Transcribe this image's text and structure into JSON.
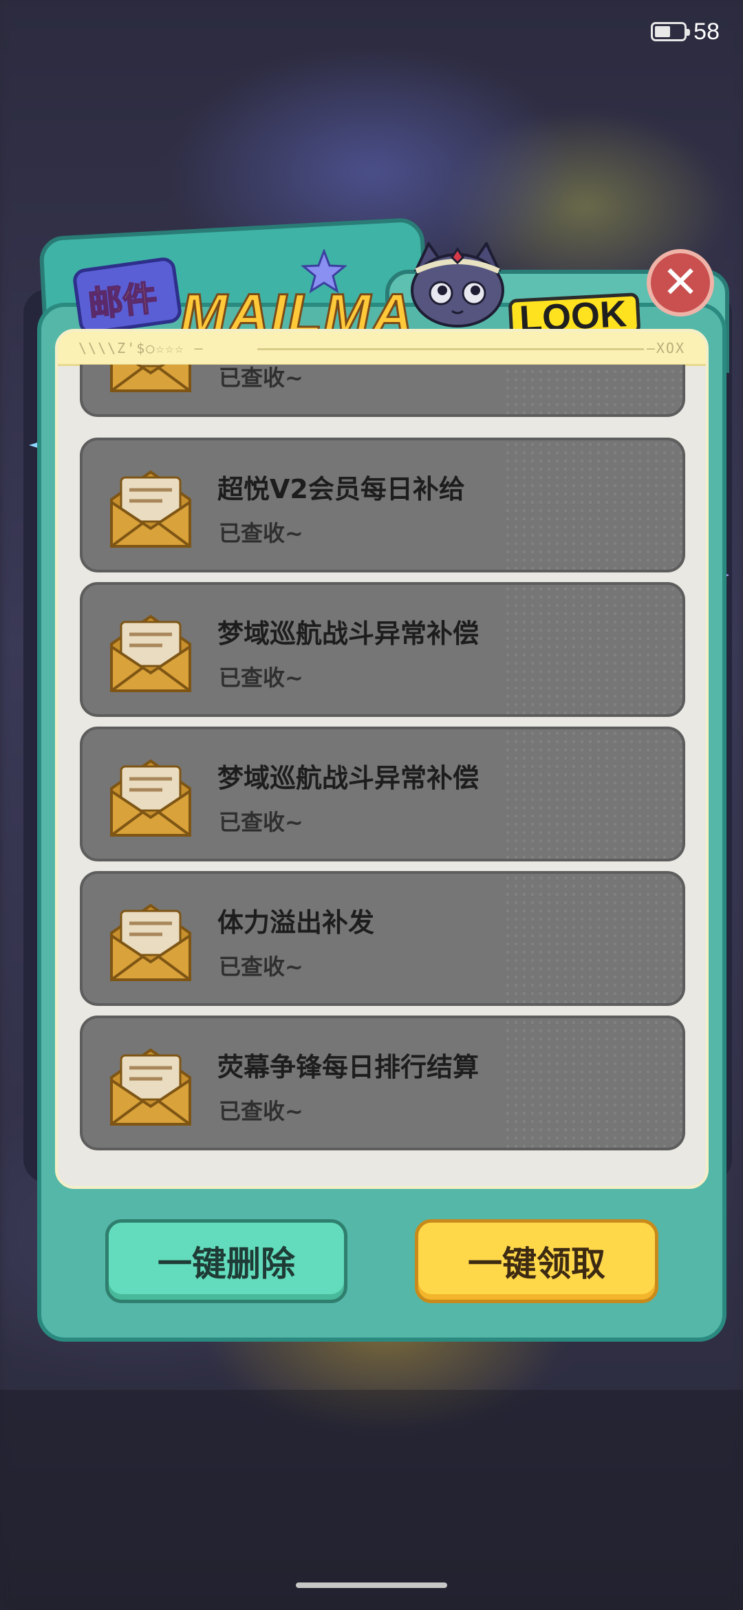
{
  "status_bar": {
    "battery_level": "58"
  },
  "dialog": {
    "badge_label": "邮件",
    "banner_text": "MAILMA",
    "look_text": "LOOK",
    "close_icon": "close-icon",
    "mails": [
      {
        "title": "",
        "status": "已查收~"
      },
      {
        "title": "超悦V2会员每日补给",
        "status": "已查收~"
      },
      {
        "title": "梦域巡航战斗异常补偿",
        "status": "已查收~"
      },
      {
        "title": "梦域巡航战斗异常补偿",
        "status": "已查收~"
      },
      {
        "title": "体力溢出补发",
        "status": "已查收~"
      },
      {
        "title": "荧幕争锋每日排行结算",
        "status": "已查收~"
      }
    ],
    "delete_all_label": "一键删除",
    "claim_all_label": "一键领取"
  },
  "colors": {
    "panel": "#55b7a8",
    "mail_card": "#767676",
    "delete_button": "#62dcbc",
    "claim_button": "#ffd84a",
    "close_button": "#c9504f"
  }
}
